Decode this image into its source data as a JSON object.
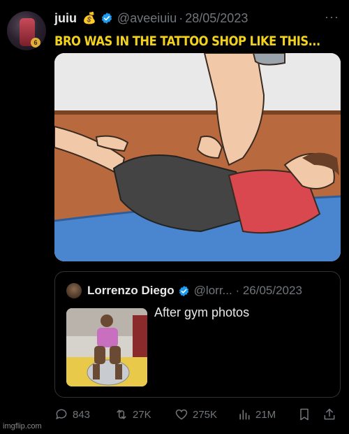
{
  "author": {
    "name": "juiu",
    "emoji": "💰",
    "handle": "@aveeiuiu",
    "date": "28/05/2023",
    "avatar_badge": "6",
    "more_label": "···"
  },
  "caption": "BRO WAS IN THE TATTOO SHOP LIKE THIS...",
  "quote": {
    "name": "Lorrenzo Diego",
    "handle": "@lorr...",
    "date": "26/05/2023",
    "text": "After gym photos"
  },
  "actions": {
    "replies": "843",
    "reposts": "27K",
    "likes": "275K",
    "views": "21M"
  },
  "watermark": "imgflip.com",
  "colors": {
    "background": "#000000",
    "caption": "#f2d21c",
    "verified": "#1d9bf0",
    "muted": "#71767b"
  }
}
